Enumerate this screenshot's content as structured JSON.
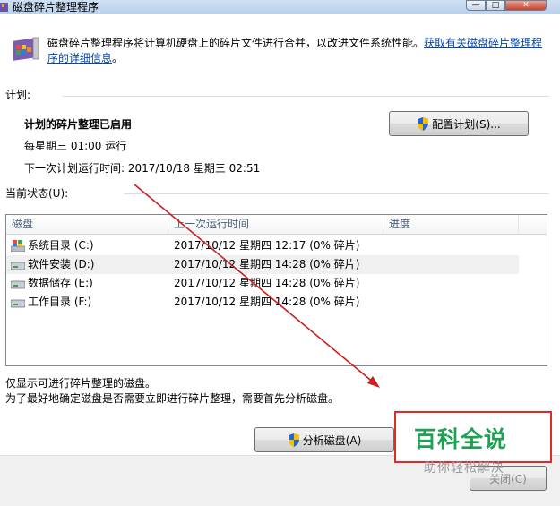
{
  "window": {
    "title": "磁盘碎片整理程序",
    "min_btn": "—",
    "max_btn": "□",
    "close_btn": "✕"
  },
  "intro": {
    "text": "磁盘碎片整理程序将计算机硬盘上的碎片文件进行合并，以改进文件系统性能。",
    "link_part1": "获取有关磁盘碎片整理程",
    "link_part2": "序的详细信息",
    "period": "。"
  },
  "schedule": {
    "section_label": "计划:",
    "status": "计划的碎片整理已启用",
    "frequency": "每星期三  01:00 运行",
    "next_run": "下一次计划运行时间: 2017/10/18 星期三 02:51",
    "configure_button": "配置计划(S)..."
  },
  "current_status": {
    "section_label": "当前状态(U):",
    "columns": [
      "磁盘",
      "上一次运行时间",
      "进度"
    ],
    "disks": [
      {
        "name": "系统目录 (C:)",
        "last_run": "2017/10/12 星期四 12:17 (0% 碎片)",
        "progress": "",
        "icon": "system-drive-icon"
      },
      {
        "name": "软件安装 (D:)",
        "last_run": "2017/10/12 星期四 14:28 (0% 碎片)",
        "progress": "",
        "icon": "hard-drive-icon"
      },
      {
        "name": "数据储存 (E:)",
        "last_run": "2017/10/12 星期四 14:28 (0% 碎片)",
        "progress": "",
        "icon": "hard-drive-icon"
      },
      {
        "name": "工作目录 (F:)",
        "last_run": "2017/10/12 星期四 14:28 (0% 碎片)",
        "progress": "",
        "icon": "hard-drive-icon"
      }
    ]
  },
  "notes": {
    "line1": "仅显示可进行碎片整理的磁盘。",
    "line2": "为了最好地确定磁盘是否需要立即进行碎片整理，需要首先分析磁盘。"
  },
  "buttons": {
    "analyze": "分析磁盘(A)",
    "close_partial": "关闭(C)"
  },
  "watermark": {
    "brand": "百科全说",
    "tagline": "助你轻松解决"
  },
  "colors": {
    "link": "#0645ad",
    "annotation_arrow": "#cc1f1f",
    "watermark_border": "#e02a2a",
    "watermark_text": "#1ea153"
  }
}
